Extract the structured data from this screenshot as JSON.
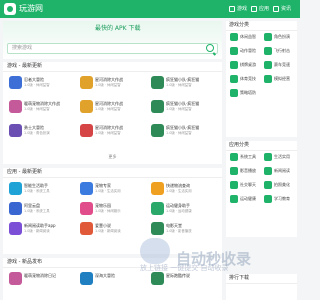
{
  "header": {
    "logo_text": "玩游网",
    "nav": [
      "游戏",
      "应用",
      "资讯"
    ]
  },
  "hero": {
    "title": "最快的 APK 下载",
    "search_placeholder": "搜索游戏"
  },
  "games_section": {
    "title": "游戏 - 最新更新",
    "items": [
      {
        "name": "忍者大冒险",
        "meta": "1.0版 · 休闲益智",
        "color": "#3d6fd6"
      },
      {
        "name": "星河消除大作战",
        "meta": "1.0版 · 休闲益智",
        "color": "#e0a22a"
      },
      {
        "name": "疯狂猫小队·疯狂猫",
        "meta": "1.0版 · 休闲益智",
        "color": "#2e8b57"
      },
      {
        "name": "暖萌宠物消除大作战",
        "meta": "1.0版 · 休闲益智",
        "color": "#c45a9a"
      },
      {
        "name": "星河消除大作战",
        "meta": "1.0版 · 休闲益智",
        "color": "#e0a22a"
      },
      {
        "name": "疯狂猫小队·疯狂猫",
        "meta": "1.0版 · 休闲益智",
        "color": "#2e8b57"
      },
      {
        "name": "勇士大冒险",
        "meta": "1.0版 · 角色扮演",
        "color": "#6b4fb3"
      },
      {
        "name": "星河消除大作战",
        "meta": "1.0版 · 休闲益智",
        "color": "#d64545"
      },
      {
        "name": "疯狂猫小队·疯狂猫",
        "meta": "1.0版 · 休闲益智",
        "color": "#2e8b57"
      }
    ],
    "more": "更多"
  },
  "apps_section": {
    "title": "应用 - 最新更新",
    "items": [
      {
        "name": "智能生活助手",
        "meta": "1.0版 · 系统工具",
        "color": "#1fa3d6"
      },
      {
        "name": "宠物专家",
        "meta": "1.0版 · 生活实用",
        "color": "#3b7be0"
      },
      {
        "name": "快递物流查询",
        "meta": "1.0版 · 生活实用",
        "color": "#f0a020"
      },
      {
        "name": "阿里云盘",
        "meta": "1.0版 · 系统工具",
        "color": "#3a66d1"
      },
      {
        "name": "宠物乐园",
        "meta": "1.0版 · 休闲娱乐",
        "color": "#e14c8a"
      },
      {
        "name": "运动健身助手",
        "meta": "1.0版 · 运动健康",
        "color": "#2aa86a"
      },
      {
        "name": "新闻阅读助手app",
        "meta": "1.0版 · 新闻阅读",
        "color": "#7b4fd6"
      },
      {
        "name": "爱壹小说",
        "meta": "1.0版 · 新闻阅读",
        "color": "#e05a3a"
      },
      {
        "name": "电影天堂",
        "meta": "1.0版 · 影音播放",
        "color": "#2e8b57"
      }
    ],
    "more": "更多"
  },
  "news_section": {
    "title": "游戏 - 新品发布",
    "items": [
      {
        "name": "暖萌宠物消除日记",
        "color": "#c45a9a"
      },
      {
        "name": "深海大冒险",
        "color": "#1f7fc0"
      },
      {
        "name": "星际跑酷传说",
        "color": "#2e8b57"
      }
    ]
  },
  "sidebar": {
    "game_categories": {
      "title": "游戏分类",
      "items": [
        "休闲益智",
        "角色扮演",
        "动作冒险",
        "飞行射击",
        "棋牌桌游",
        "赛车竞速",
        "体育竞技",
        "模拟经营",
        "策略塔防"
      ]
    },
    "app_categories": {
      "title": "应用分类",
      "items": [
        "系统工具",
        "生活实用",
        "影音播放",
        "新闻阅读",
        "社交聊天",
        "拍照美化",
        "运动健康",
        "学习教育"
      ]
    },
    "ranking": {
      "title": "排行下载"
    }
  },
  "watermark": {
    "big": "自动秒收录",
    "small": "放上链接 一键提交 自动收录"
  }
}
